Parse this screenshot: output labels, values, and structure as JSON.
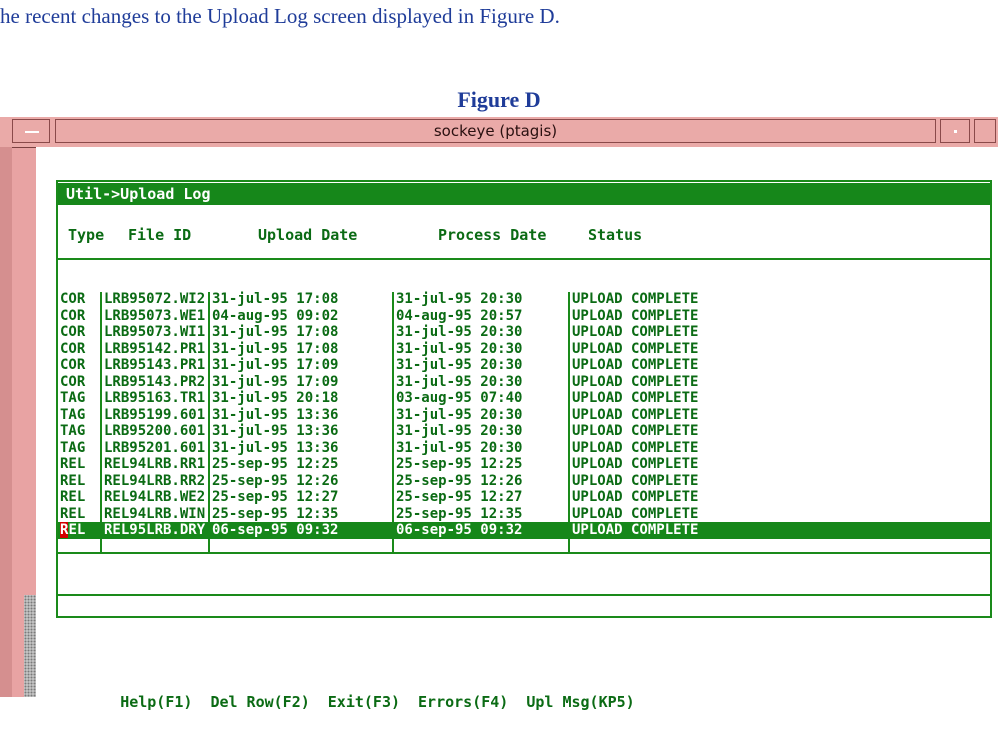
{
  "document": {
    "intro_text": "he recent changes to the Upload Log screen displayed in Figure D.",
    "figure_caption": "Figure D"
  },
  "window": {
    "title": "sockeye (ptagis)"
  },
  "screen": {
    "header": "Util->Upload Log",
    "columns": [
      "Type",
      "File ID",
      "Upload Date",
      "Process Date",
      "Status"
    ],
    "rows": [
      {
        "type": "COR",
        "file_id": "LRB95072.WI2",
        "upload_date": "31-jul-95 17:08",
        "process_date": "31-jul-95 20:30",
        "status": "UPLOAD COMPLETE"
      },
      {
        "type": "COR",
        "file_id": "LRB95073.WE1",
        "upload_date": "04-aug-95 09:02",
        "process_date": "04-aug-95 20:57",
        "status": "UPLOAD COMPLETE"
      },
      {
        "type": "COR",
        "file_id": "LRB95073.WI1",
        "upload_date": "31-jul-95 17:08",
        "process_date": "31-jul-95 20:30",
        "status": "UPLOAD COMPLETE"
      },
      {
        "type": "COR",
        "file_id": "LRB95142.PR1",
        "upload_date": "31-jul-95 17:08",
        "process_date": "31-jul-95 20:30",
        "status": "UPLOAD COMPLETE"
      },
      {
        "type": "COR",
        "file_id": "LRB95143.PR1",
        "upload_date": "31-jul-95 17:09",
        "process_date": "31-jul-95 20:30",
        "status": "UPLOAD COMPLETE"
      },
      {
        "type": "COR",
        "file_id": "LRB95143.PR2",
        "upload_date": "31-jul-95 17:09",
        "process_date": "31-jul-95 20:30",
        "status": "UPLOAD COMPLETE"
      },
      {
        "type": "TAG",
        "file_id": "LRB95163.TR1",
        "upload_date": "31-jul-95 20:18",
        "process_date": "03-aug-95 07:40",
        "status": "UPLOAD COMPLETE"
      },
      {
        "type": "TAG",
        "file_id": "LRB95199.601",
        "upload_date": "31-jul-95 13:36",
        "process_date": "31-jul-95 20:30",
        "status": "UPLOAD COMPLETE"
      },
      {
        "type": "TAG",
        "file_id": "LRB95200.601",
        "upload_date": "31-jul-95 13:36",
        "process_date": "31-jul-95 20:30",
        "status": "UPLOAD COMPLETE"
      },
      {
        "type": "TAG",
        "file_id": "LRB95201.601",
        "upload_date": "31-jul-95 13:36",
        "process_date": "31-jul-95 20:30",
        "status": "UPLOAD COMPLETE"
      },
      {
        "type": "REL",
        "file_id": "REL94LRB.RR1",
        "upload_date": "25-sep-95 12:25",
        "process_date": "25-sep-95 12:25",
        "status": "UPLOAD COMPLETE"
      },
      {
        "type": "REL",
        "file_id": "REL94LRB.RR2",
        "upload_date": "25-sep-95 12:26",
        "process_date": "25-sep-95 12:26",
        "status": "UPLOAD COMPLETE"
      },
      {
        "type": "REL",
        "file_id": "REL94LRB.WE2",
        "upload_date": "25-sep-95 12:27",
        "process_date": "25-sep-95 12:27",
        "status": "UPLOAD COMPLETE"
      },
      {
        "type": "REL",
        "file_id": "REL94LRB.WIN",
        "upload_date": "25-sep-95 12:35",
        "process_date": "25-sep-95 12:35",
        "status": "UPLOAD COMPLETE"
      },
      {
        "type": "REL",
        "file_id": "REL95LRB.DRY",
        "upload_date": "06-sep-95 09:32",
        "process_date": "06-sep-95 09:32",
        "status": "UPLOAD COMPLETE"
      }
    ],
    "selected_row_index": 14,
    "cursor_char": "R",
    "selected_type_rest": "EL",
    "function_keys": [
      "Help(F1)",
      "Del Row(F2)",
      "Exit(F3)",
      "Errors(F4)",
      "Upl Msg(KP5)"
    ]
  },
  "colors": {
    "terminal_green": "#16871a",
    "window_frame": "#e8a3a3",
    "cursor": "#d40000",
    "caption_blue": "#1f3c99"
  }
}
